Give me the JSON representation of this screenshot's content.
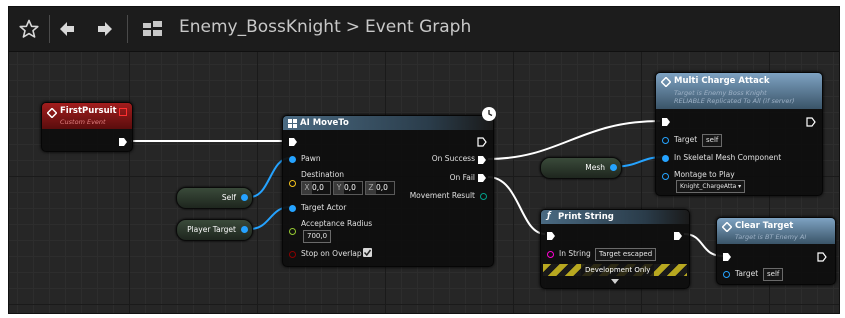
{
  "toolbar": {
    "breadcrumb_asset": "Enemy_BossKnight",
    "breadcrumb_separator": ">",
    "breadcrumb_graph": "Event Graph",
    "icons": [
      "star-icon",
      "back-arrow-icon",
      "forward-arrow-icon",
      "blueprint-graph-icon"
    ]
  },
  "colors": {
    "event_header": "#8c1a1a",
    "function_header": "#3d5d72",
    "exec_wire": "#ffffff",
    "object_pin": "#25a3ff",
    "vector_pin": "#f7c41c",
    "float_pin": "#95c831",
    "bool_pin": "#8c0000",
    "string_pin": "#ff00d4"
  },
  "nodes": {
    "first_pursuit": {
      "title": "FirstPursuit",
      "subtitle": "Custom Event"
    },
    "ai_move_to": {
      "title": "AI MoveTo",
      "pawn": "Pawn",
      "destination": "Destination",
      "dest_x": "0,0",
      "dest_y": "0,0",
      "dest_z": "0,0",
      "axis_x": "X",
      "axis_y": "Y",
      "axis_z": "Z",
      "target_actor": "Target Actor",
      "acceptance_radius": "Acceptance Radius",
      "acceptance_value": "700,0",
      "stop_on_overlap": "Stop on Overlap",
      "on_success": "On Success",
      "on_fail": "On Fail",
      "movement_result": "Movement Result"
    },
    "self_var": {
      "label": "Self"
    },
    "player_target_var": {
      "label": "Player Target"
    },
    "mesh_var": {
      "label": "Mesh"
    },
    "multi_charge_attack": {
      "title": "Multi Charge Attack",
      "subtitle1": "Target is Enemy Boss Knight",
      "subtitle2": "RELIABLE Replicated To All (if server)",
      "target": "Target",
      "target_value": "self",
      "in_skeletal": "In Skeletal Mesh Component",
      "montage": "Montage to Play",
      "montage_value": "Knight_ChargeAtta ▾"
    },
    "print_string": {
      "title": "Print String",
      "in_string": "In String",
      "in_string_value": "Target escaped",
      "dev_only": "Development Only"
    },
    "clear_target": {
      "title": "Clear Target",
      "subtitle": "Target is BT Enemy AI",
      "target": "Target",
      "target_value": "self"
    }
  }
}
